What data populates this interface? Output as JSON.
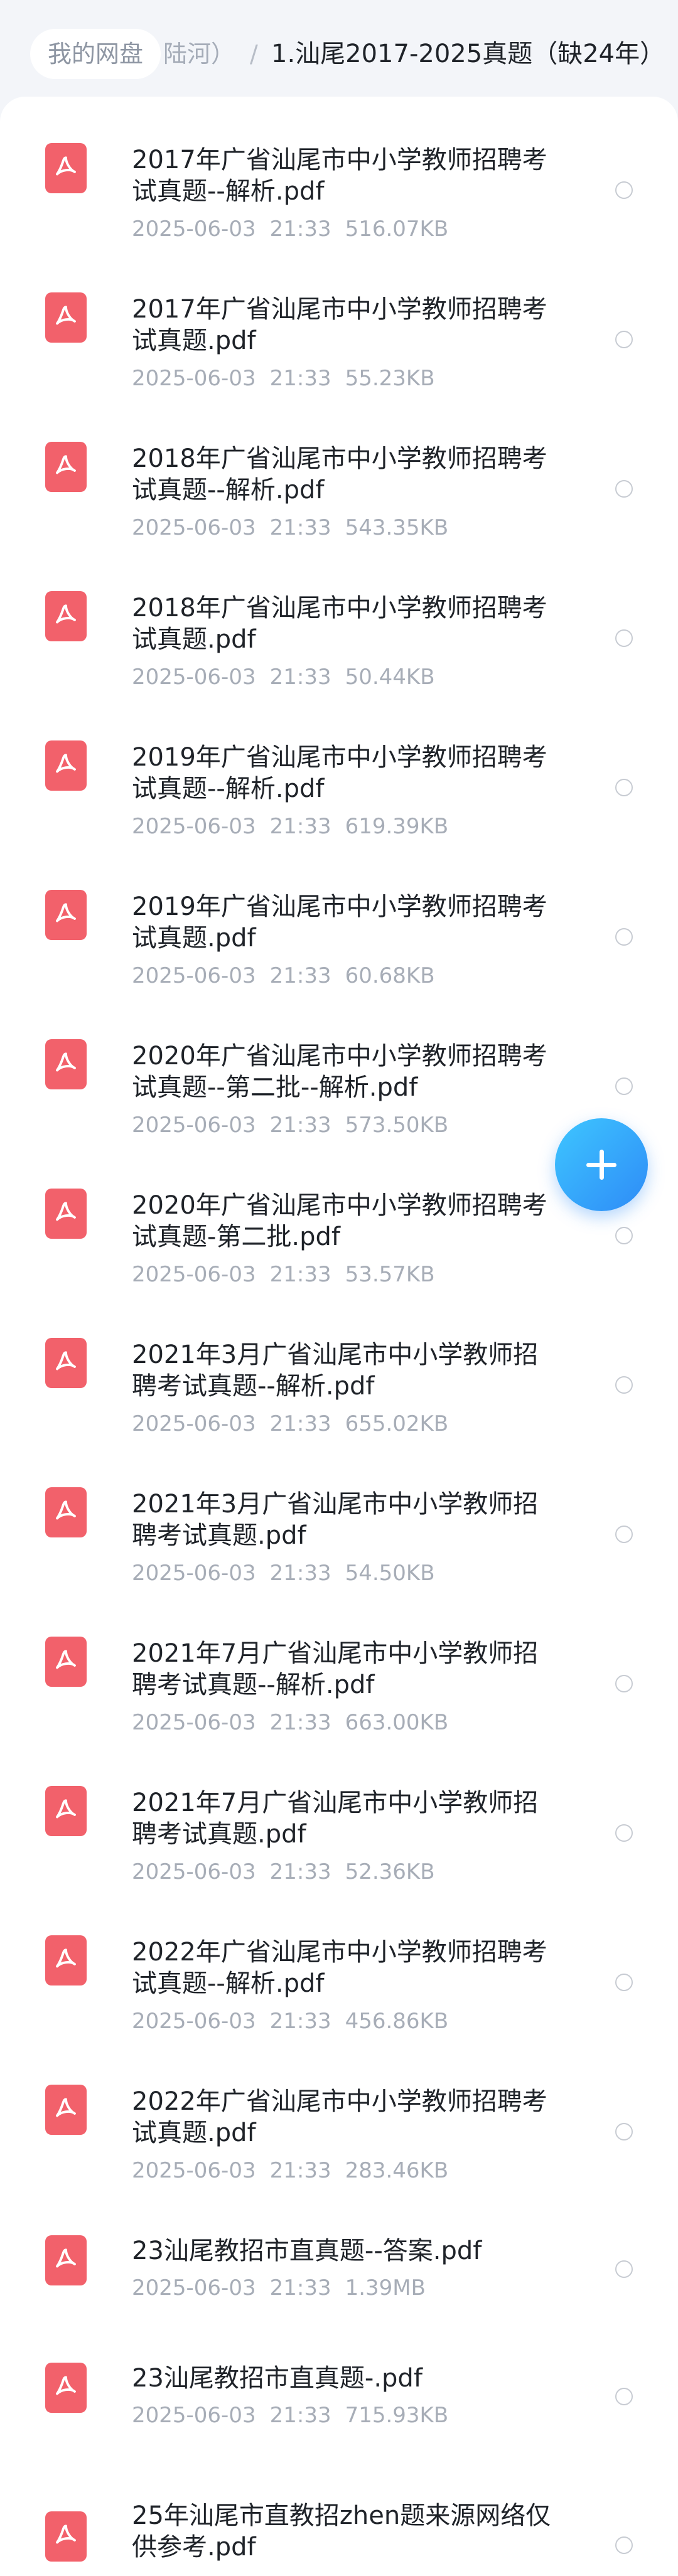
{
  "breadcrumb": {
    "home": "我的网盘",
    "parent": "陆河）",
    "separator": "/",
    "current": "1.汕尾2017-2025真题（缺24年）"
  },
  "files": [
    {
      "line1": "2017年广省汕尾市中小学教师招聘考",
      "line2": "试真题--解析.pdf",
      "date": "2025-06-03",
      "time": "21:33",
      "size": "516.07KB"
    },
    {
      "line1": "2017年广省汕尾市中小学教师招聘考",
      "line2": "试真题.pdf",
      "date": "2025-06-03",
      "time": "21:33",
      "size": "55.23KB"
    },
    {
      "line1": "2018年广省汕尾市中小学教师招聘考",
      "line2": "试真题--解析.pdf",
      "date": "2025-06-03",
      "time": "21:33",
      "size": "543.35KB"
    },
    {
      "line1": "2018年广省汕尾市中小学教师招聘考",
      "line2": "试真题.pdf",
      "date": "2025-06-03",
      "time": "21:33",
      "size": "50.44KB"
    },
    {
      "line1": "2019年广省汕尾市中小学教师招聘考",
      "line2": "试真题--解析.pdf",
      "date": "2025-06-03",
      "time": "21:33",
      "size": "619.39KB"
    },
    {
      "line1": "2019年广省汕尾市中小学教师招聘考",
      "line2": "试真题.pdf",
      "date": "2025-06-03",
      "time": "21:33",
      "size": "60.68KB"
    },
    {
      "line1": "2020年广省汕尾市中小学教师招聘考",
      "line2": "试真题--第二批--解析.pdf",
      "date": "2025-06-03",
      "time": "21:33",
      "size": "573.50KB"
    },
    {
      "line1": "2020年广省汕尾市中小学教师招聘考",
      "line2": "试真题-第二批.pdf",
      "date": "2025-06-03",
      "time": "21:33",
      "size": "53.57KB"
    },
    {
      "line1": "2021年3月广省汕尾市中小学教师招",
      "line2": "聘考试真题--解析.pdf",
      "date": "2025-06-03",
      "time": "21:33",
      "size": "655.02KB"
    },
    {
      "line1": "2021年3月广省汕尾市中小学教师招",
      "line2": "聘考试真题.pdf",
      "date": "2025-06-03",
      "time": "21:33",
      "size": "54.50KB"
    },
    {
      "line1": "2021年7月广省汕尾市中小学教师招",
      "line2": "聘考试真题--解析.pdf",
      "date": "2025-06-03",
      "time": "21:33",
      "size": "663.00KB"
    },
    {
      "line1": "2021年7月广省汕尾市中小学教师招",
      "line2": "聘考试真题.pdf",
      "date": "2025-06-03",
      "time": "21:33",
      "size": "52.36KB"
    },
    {
      "line1": "2022年广省汕尾市中小学教师招聘考",
      "line2": "试真题--解析.pdf",
      "date": "2025-06-03",
      "time": "21:33",
      "size": "456.86KB"
    },
    {
      "line1": "2022年广省汕尾市中小学教师招聘考",
      "line2": "试真题.pdf",
      "date": "2025-06-03",
      "time": "21:33",
      "size": "283.46KB"
    },
    {
      "line1": "23汕尾教招市直真题--答案.pdf",
      "line2": "",
      "date": "2025-06-03",
      "time": "21:33",
      "size": "1.39MB"
    },
    {
      "line1": "23汕尾教招市直真题-.pdf",
      "line2": "",
      "date": "2025-06-03",
      "time": "21:33",
      "size": "715.93KB"
    },
    {
      "line1": "25年汕尾市直教招zhen题来源网络仅",
      "line2": "供参考.pdf",
      "date": "",
      "time": "",
      "size": ""
    }
  ],
  "icons": {
    "file": "pdf-file-icon",
    "select": "select-radio-icon",
    "fab": "plus-icon"
  },
  "colors": {
    "pdf": "#f2616b",
    "fab_start": "#3ec6ff",
    "fab_end": "#2e8bf7"
  }
}
